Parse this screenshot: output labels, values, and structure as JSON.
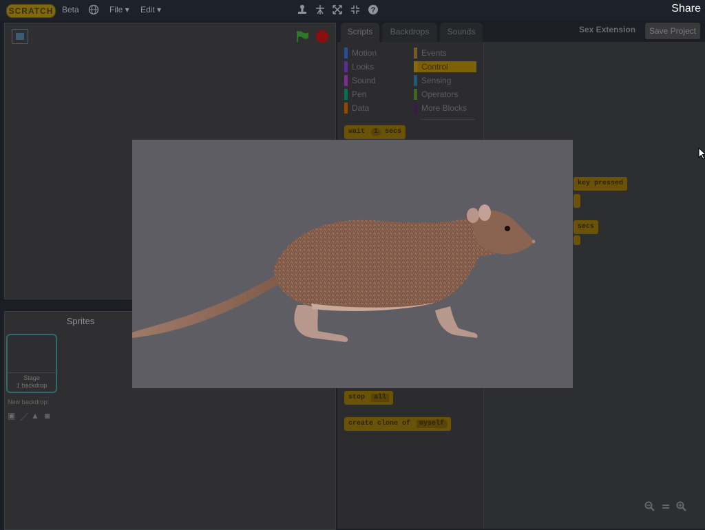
{
  "menubar": {
    "logo_text": "SCRATCH",
    "beta_label": "Beta",
    "file_label": "File ▾",
    "edit_label": "Edit ▾",
    "share_label": "Share"
  },
  "sprites": {
    "title": "Sprites",
    "stage_label": "Stage",
    "stage_sub": "1 backdrop",
    "new_backdrop_label": "New backdrop:"
  },
  "scripts": {
    "tabs": [
      "Scripts",
      "Backdrops",
      "Sounds"
    ],
    "extension_title": "Sex Extension",
    "save_label": "Save Project",
    "categories_left": [
      {
        "label": "Motion",
        "color": "#2b4d8b"
      },
      {
        "label": "Looks",
        "color": "#5a2f8b"
      },
      {
        "label": "Sound",
        "color": "#7a2f8b"
      },
      {
        "label": "Pen",
        "color": "#0c6e4e"
      },
      {
        "label": "Data",
        "color": "#8b4a0c"
      }
    ],
    "categories_right": [
      {
        "label": "Events",
        "color": "#7a5a1a"
      },
      {
        "label": "Control",
        "color": "#8b6a07"
      },
      {
        "label": "Sensing",
        "color": "#1a5a7a"
      },
      {
        "label": "Operators",
        "color": "#3a6a1a"
      },
      {
        "label": "More Blocks",
        "color": "#3a1a4a"
      }
    ],
    "palette_blocks": {
      "wait": "wait",
      "wait_num": "1",
      "wait_unit": "secs",
      "stop": "stop",
      "stop_opt": "all",
      "clone": "create clone of",
      "clone_opt": "myself"
    },
    "script_blocks": {
      "key_pressed": "key pressed",
      "secs": "secs"
    }
  },
  "colors": {
    "accent_control": "#8b6a07",
    "stop_red": "#8b0d0d",
    "flag_green": "#2a7a2a",
    "modal_bg": "#5f5d64"
  }
}
